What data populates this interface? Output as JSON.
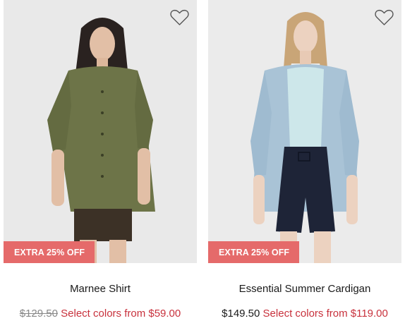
{
  "products": [
    {
      "name": "Marnee Shirt",
      "badge": "EXTRA 25% OFF",
      "original_price": "$129.50",
      "original_struck": true,
      "sale_text": "Select colors from $59.00",
      "image_desc_icon": "model-photo",
      "wishlist_icon": "heart-icon"
    },
    {
      "name": "Essential Summer Cardigan",
      "badge": "EXTRA 25% OFF",
      "original_price": "$149.50",
      "original_struck": false,
      "sale_text": "Select colors from $119.00",
      "image_desc_icon": "model-photo",
      "wishlist_icon": "heart-icon"
    }
  ],
  "colors": {
    "badge_bg": "#e56a6a",
    "sale_text": "#c8313c",
    "image_bg": "#e8e8e8"
  }
}
